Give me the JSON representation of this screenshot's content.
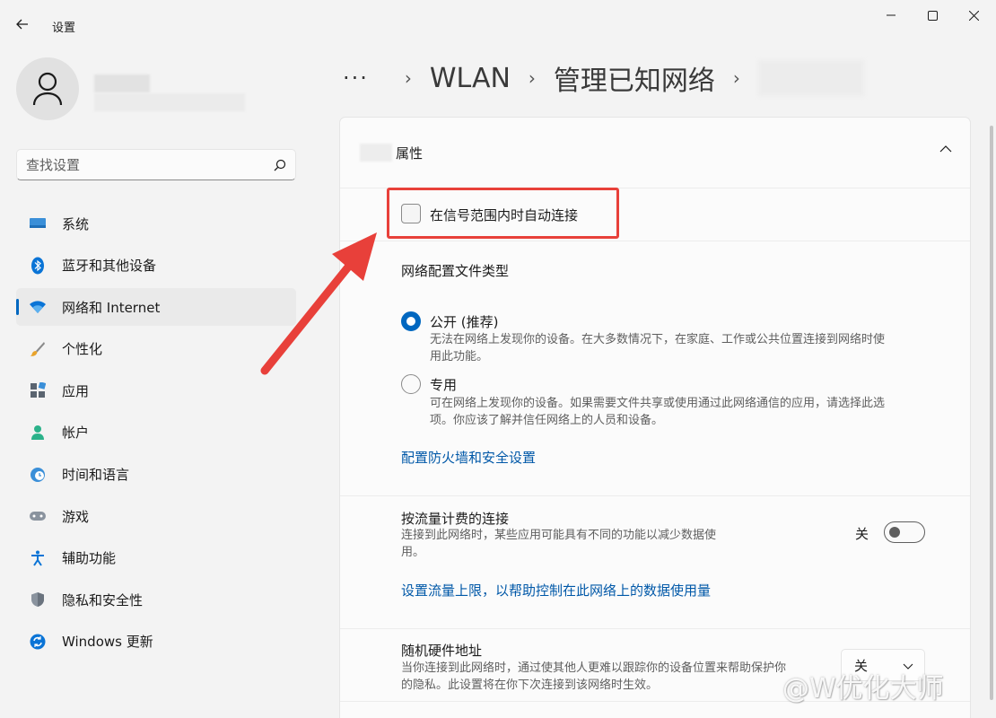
{
  "window": {
    "title": "设置",
    "minimize_label": "—",
    "maximize_label": "☐",
    "close_label": "✕"
  },
  "search": {
    "placeholder": "查找设置"
  },
  "sidebar": {
    "items": [
      {
        "label": "系统",
        "icon": "monitor-icon",
        "active": false
      },
      {
        "label": "蓝牙和其他设备",
        "icon": "bluetooth-icon",
        "active": false
      },
      {
        "label": "网络和 Internet",
        "icon": "wifi-icon",
        "active": true
      },
      {
        "label": "个性化",
        "icon": "brush-icon",
        "active": false
      },
      {
        "label": "应用",
        "icon": "apps-icon",
        "active": false
      },
      {
        "label": "帐户",
        "icon": "person-icon",
        "active": false
      },
      {
        "label": "时间和语言",
        "icon": "clock-globe-icon",
        "active": false
      },
      {
        "label": "游戏",
        "icon": "gamepad-icon",
        "active": false
      },
      {
        "label": "辅助功能",
        "icon": "accessibility-icon",
        "active": false
      },
      {
        "label": "隐私和安全性",
        "icon": "shield-icon",
        "active": false
      },
      {
        "label": "Windows 更新",
        "icon": "update-icon",
        "active": false
      }
    ]
  },
  "breadcrumb": {
    "dots": "···",
    "items": [
      "WLAN",
      "管理已知网络"
    ]
  },
  "panel": {
    "header_title": "属性",
    "auto_connect_label": "在信号范围内时自动连接",
    "auto_connect_checked": false,
    "profile_type_title": "网络配置文件类型",
    "public": {
      "label": "公开 (推荐)",
      "desc_line1": "无法在网络上发现你的设备。在大多数情况下，在家庭、工作或公共位置连接到网络时使",
      "desc_line2": "用此功能。",
      "selected": true
    },
    "private": {
      "label": "专用",
      "desc_line1": "可在网络上发现你的设备。如果需要文件共享或使用通过此网络通信的应用，请选择此选",
      "desc_line2": "项。你应该了解并信任网络上的人员和设备。",
      "selected": false
    },
    "firewall_link": "配置防火墙和安全设置",
    "metered": {
      "title": "按流量计费的连接",
      "desc_line1": "连接到此网络时，某些应用可能具有不同的功能以减少数据使",
      "desc_line2": "用。",
      "state_label": "关",
      "on": false
    },
    "data_limit_link": "设置流量上限，以帮助控制在此网络上的数据使用量",
    "random_mac": {
      "title": "随机硬件地址",
      "desc_line1": "当你连接到此网络时，通过使其他人更难以跟踪你的设备位置来帮助保护你",
      "desc_line2": "的隐私。此设置将在你下次连接到该网络时生效。",
      "selected_value": "关"
    }
  },
  "watermark": "@W优化大师",
  "colors": {
    "accent": "#0067c0",
    "link": "#0058a8",
    "annotation": "#e8403a"
  }
}
